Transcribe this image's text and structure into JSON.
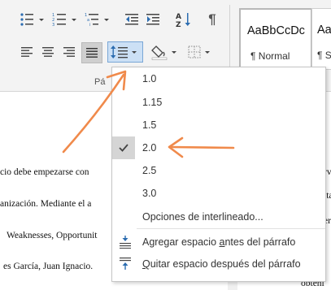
{
  "ribbon": {
    "group_label": "Pá",
    "styles": [
      {
        "sample": "AaBbCcDc",
        "name": "¶ Normal"
      },
      {
        "sample": "AaB",
        "name": "¶ Si"
      }
    ],
    "icons": {
      "bullets": "bullets-list-icon",
      "numbering": "numbered-list-icon",
      "multilevel": "multilevel-list-icon",
      "decrease_indent": "decrease-indent-icon",
      "increase_indent": "increase-indent-icon",
      "sort": "sort-az-icon",
      "pilcrow": "pilcrow-icon",
      "line_spacing": "line-spacing-icon",
      "shading": "shading-bucket-icon",
      "borders": "borders-icon"
    },
    "sort_label": "A\nZ",
    "pilcrow": "¶"
  },
  "document": {
    "lines": [
      "cio debe empezarse con",
      "anización. Mediante el a",
      "Weaknesses, Opportunit",
      "es García, Juan Ignacio."
    ],
    "right_fragments": [
      "rv",
      "ita",
      "era",
      "obteni"
    ]
  },
  "line_spacing_menu": {
    "options": [
      "1.0",
      "1.15",
      "1.5",
      "2.0",
      "2.5",
      "3.0"
    ],
    "selected": "2.0",
    "more_options": "Opciones de interlineado...",
    "add_before": {
      "pre": "Agregar espacio ",
      "key": "a",
      "post": "ntes del párrafo"
    },
    "remove_after": {
      "pre": "",
      "key": "Q",
      "post": "uitar espacio después del párrafo"
    }
  },
  "colors": {
    "annotation": "#f08a4b",
    "accent_blue": "#2b6cb0",
    "selected_bg": "#d5d5d5"
  }
}
